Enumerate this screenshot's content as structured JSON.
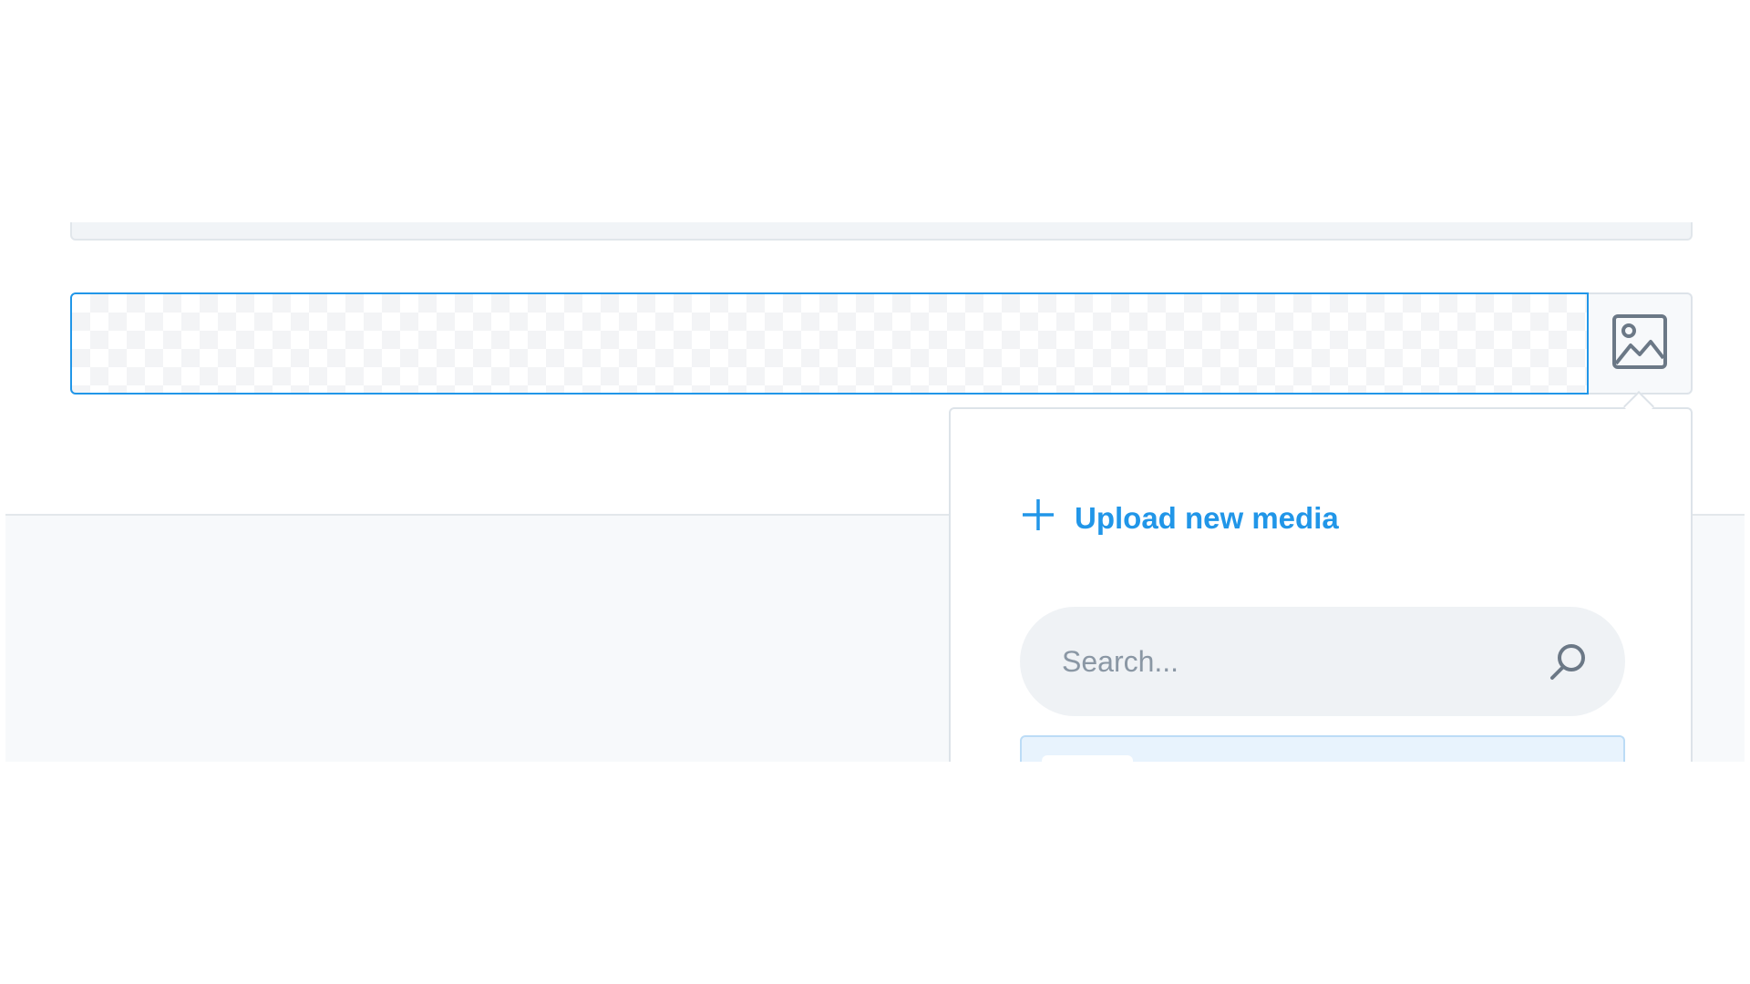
{
  "media_picker": {
    "upload_label": "Upload new media",
    "search": {
      "placeholder": "Search...",
      "value": ""
    }
  },
  "icons": {
    "media_button": "image-icon",
    "upload": "plus-icon",
    "search": "search-icon"
  },
  "colors": {
    "accent": "#2196e8",
    "input_border_focus": "#2196e8",
    "neutral_border": "#dde3e9",
    "search_bg": "#eff2f5",
    "icon_grey": "#6b7886"
  }
}
